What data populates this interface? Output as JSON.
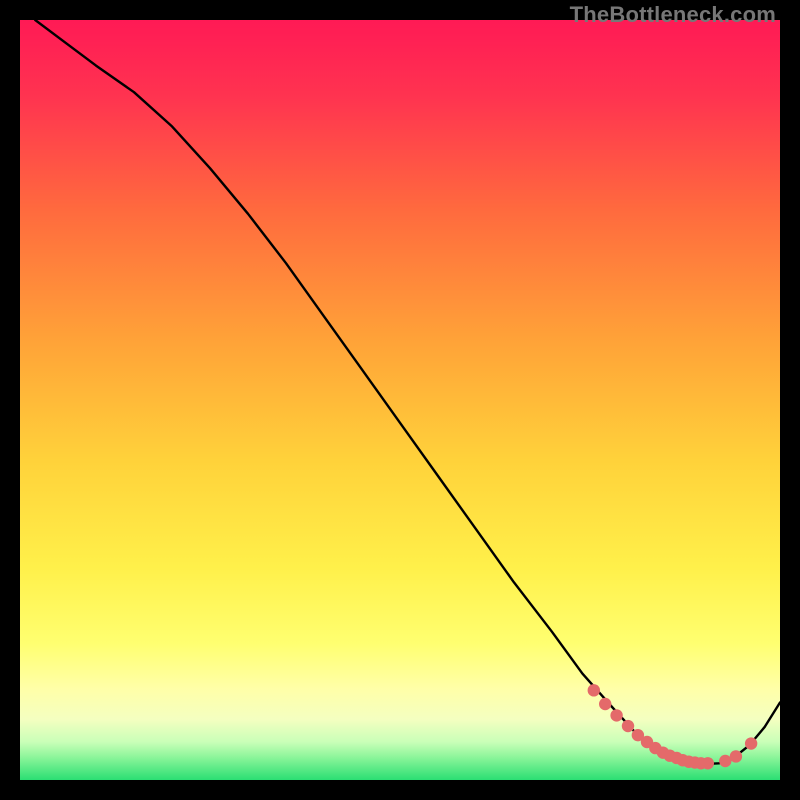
{
  "watermark": "TheBottleneck.com",
  "colors": {
    "bg_black": "#000000",
    "curve": "#000000",
    "marker_fill": "#e46a6a",
    "marker_stroke": "#d44",
    "grad_top": "#ff1a4d",
    "grad_mid1": "#ff5a3c",
    "grad_mid2": "#ffb030",
    "grad_mid3": "#ffe040",
    "grad_mid4": "#ffff66",
    "grad_yellowband": "#ffffb0",
    "grad_bottom": "#2bdf73"
  },
  "chart_data": {
    "type": "line",
    "title": "",
    "xlabel": "",
    "ylabel": "",
    "xlim": [
      0,
      100
    ],
    "ylim": [
      0,
      100
    ],
    "series": [
      {
        "name": "curve",
        "x": [
          2,
          6,
          10,
          15,
          20,
          25,
          30,
          35,
          40,
          45,
          50,
          55,
          60,
          65,
          70,
          74,
          78,
          81,
          84,
          86,
          88,
          90,
          92,
          94,
          96,
          98,
          100
        ],
        "y": [
          100,
          97,
          94,
          90.5,
          86,
          80.5,
          74.5,
          68,
          61,
          54,
          47,
          40,
          33,
          26,
          19.5,
          14,
          9.5,
          6.2,
          4.1,
          3.0,
          2.4,
          2.1,
          2.2,
          3.0,
          4.6,
          7.0,
          10.2
        ]
      }
    ],
    "markers": {
      "name": "highlight-points",
      "x": [
        75.5,
        77,
        78.5,
        80,
        81.3,
        82.5,
        83.6,
        84.6,
        85.5,
        86.4,
        87.2,
        88,
        88.8,
        89.6,
        90.5,
        92.8,
        94.2,
        96.2
      ],
      "y": [
        11.8,
        10.0,
        8.5,
        7.1,
        5.9,
        5.0,
        4.2,
        3.6,
        3.2,
        2.9,
        2.6,
        2.4,
        2.3,
        2.2,
        2.2,
        2.5,
        3.1,
        4.8
      ]
    }
  }
}
